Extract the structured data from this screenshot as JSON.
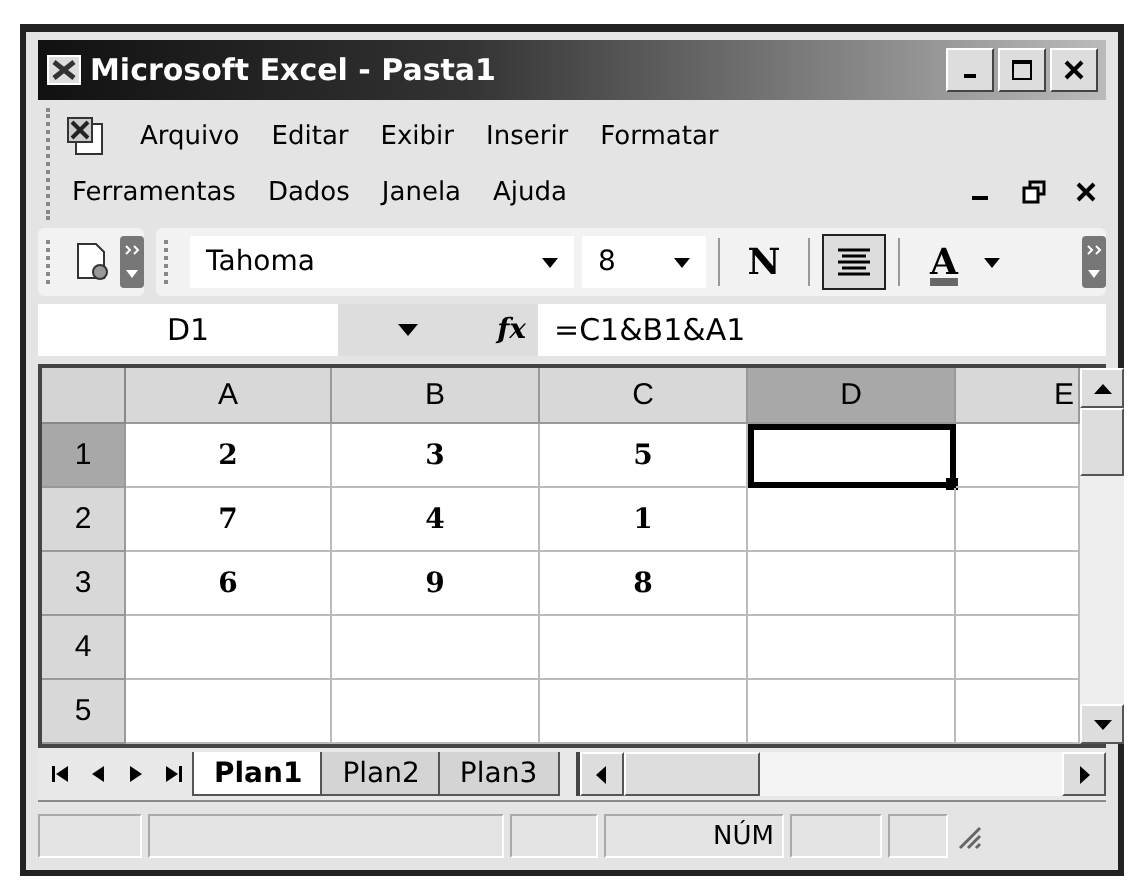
{
  "window": {
    "title": "Microsoft Excel - Pasta1"
  },
  "menu_rows": [
    [
      {
        "label": "Arquivo"
      },
      {
        "label": "Editar"
      },
      {
        "label": "Exibir"
      },
      {
        "label": "Inserir"
      },
      {
        "label": "Formatar"
      }
    ],
    [
      {
        "label": "Ferramentas"
      },
      {
        "label": "Dados"
      },
      {
        "label": "Janela"
      },
      {
        "label": "Ajuda"
      }
    ]
  ],
  "toolbar": {
    "font": "Tahoma",
    "size": "8",
    "bold": {
      "label": "N",
      "pressed": false
    },
    "center": {
      "pressed": true
    },
    "font_color": {
      "label": "A"
    }
  },
  "formula_bar": {
    "name_box": "D1",
    "fx": "fx",
    "formula": "=C1&B1&A1"
  },
  "sheet": {
    "columns": [
      {
        "label": "A",
        "selected": false
      },
      {
        "label": "B",
        "selected": false
      },
      {
        "label": "C",
        "selected": false
      },
      {
        "label": "D",
        "selected": true
      },
      {
        "label": "E",
        "selected": false
      }
    ],
    "rows": [
      {
        "label": "1",
        "selected": true,
        "cells": [
          {
            "value": "2",
            "selected": false
          },
          {
            "value": "3",
            "selected": false
          },
          {
            "value": "5",
            "selected": false
          },
          {
            "selected": true
          },
          {
            "selected": false
          }
        ]
      },
      {
        "label": "2",
        "selected": false,
        "cells": [
          {
            "value": "7",
            "selected": false
          },
          {
            "value": "4",
            "selected": false
          },
          {
            "value": "1",
            "selected": false
          },
          {
            "selected": false
          },
          {
            "selected": false
          }
        ]
      },
      {
        "label": "3",
        "selected": false,
        "cells": [
          {
            "value": "6",
            "selected": false
          },
          {
            "value": "9",
            "selected": false
          },
          {
            "value": "8",
            "selected": false
          },
          {
            "selected": false
          },
          {
            "selected": false
          }
        ]
      },
      {
        "label": "4",
        "selected": false,
        "cells": [
          {
            "selected": false
          },
          {
            "selected": false
          },
          {
            "selected": false
          },
          {
            "selected": false
          },
          {
            "selected": false
          }
        ]
      },
      {
        "label": "5",
        "selected": false,
        "cells": [
          {
            "selected": false
          },
          {
            "selected": false
          },
          {
            "selected": false
          },
          {
            "selected": false
          },
          {
            "selected": false
          }
        ]
      }
    ]
  },
  "sheet_tabs": [
    {
      "label": "Plan1",
      "selected": true
    },
    {
      "label": "Plan2",
      "selected": false
    },
    {
      "label": "Plan3",
      "selected": false
    }
  ],
  "status_bar": {
    "mode": "NÚM"
  }
}
